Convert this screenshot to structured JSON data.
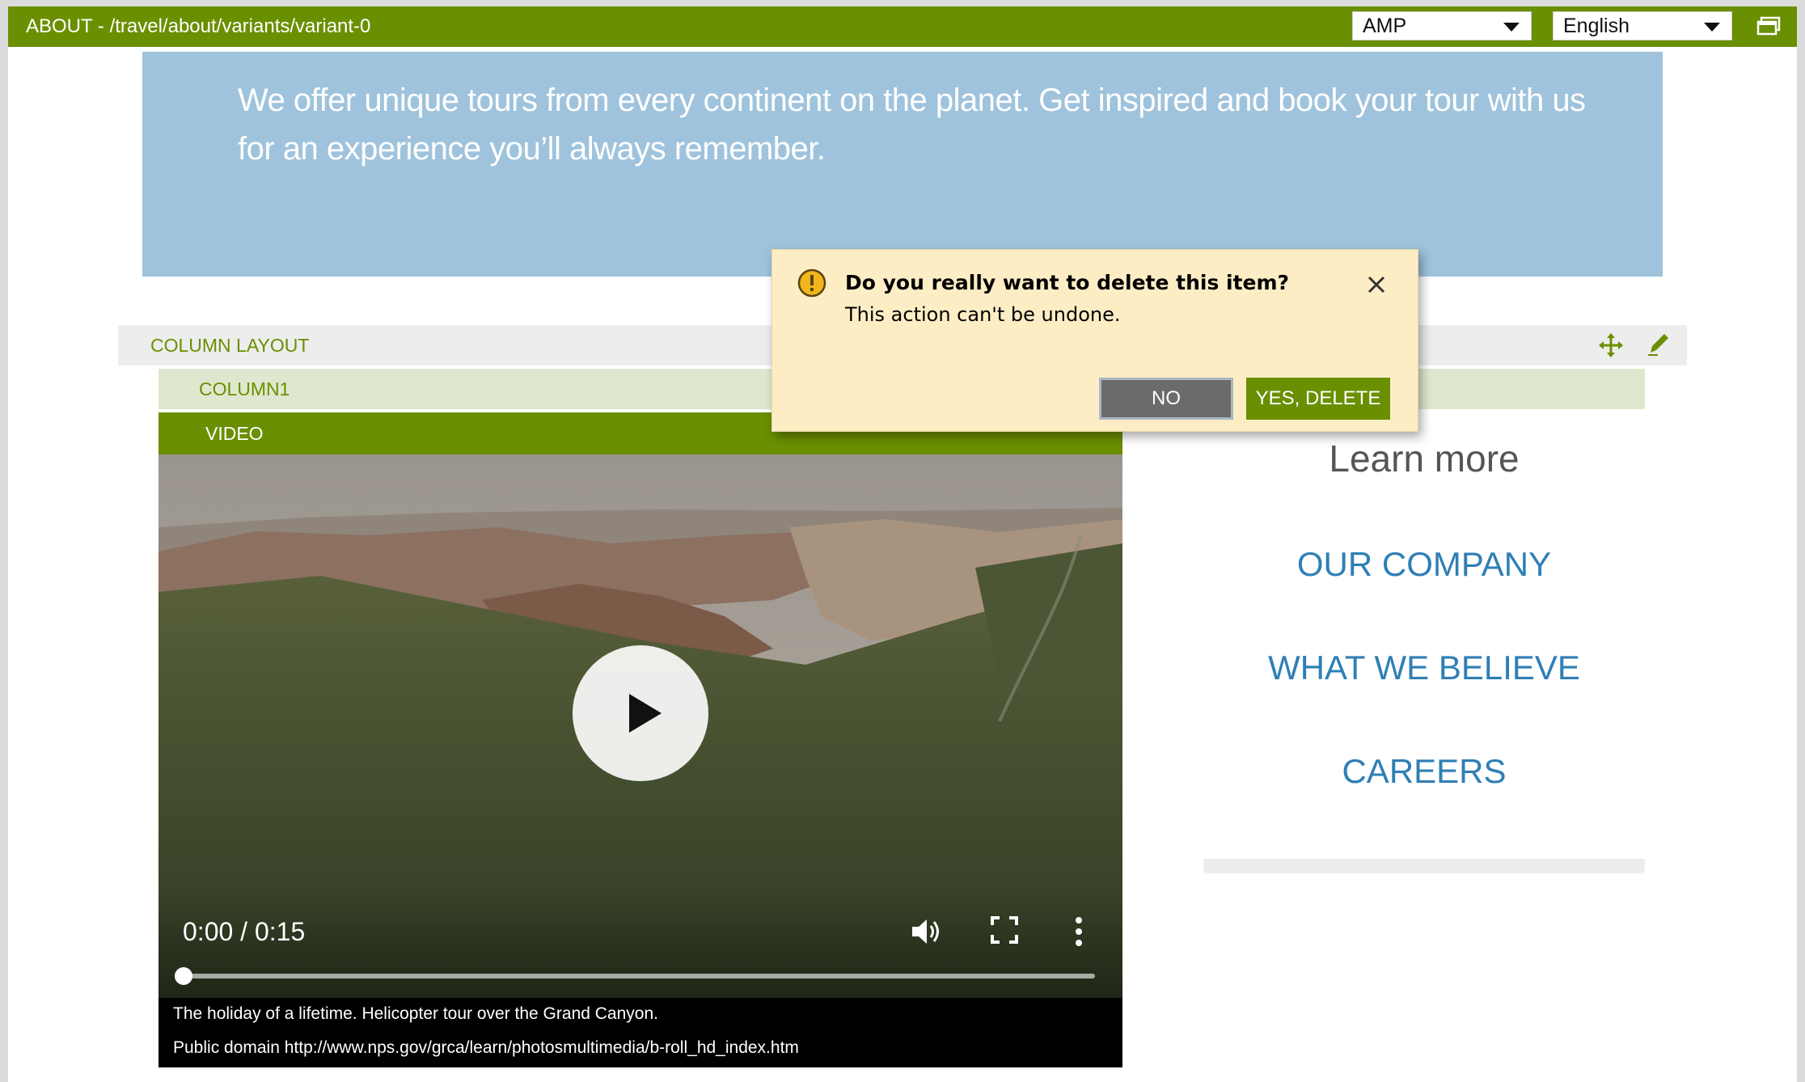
{
  "topbar": {
    "path": "ABOUT - /travel/about/variants/variant-0",
    "renderer_value": "AMP",
    "language_value": "English",
    "window_icon": "new-window-icon"
  },
  "hero": {
    "text": "We offer unique tours from every continent on the planet. Get inspired and book your tour with us for an experience you’ll always remember."
  },
  "column_layout": {
    "label": "COLUMN LAYOUT",
    "icons": [
      "move-icon",
      "edit-icon"
    ]
  },
  "column1": {
    "label": "COLUMN1"
  },
  "video": {
    "label": "VIDEO",
    "time": "0:00 / 0:15",
    "progress": 0,
    "caption_line1": "The holiday of a lifetime. Helicopter tour over the Grand Canyon.",
    "caption_line2": "Public domain http://www.nps.gov/grca/learn/photosmultimedia/b-roll_hd_index.htm",
    "icons": [
      "play-icon",
      "volume-icon",
      "fullscreen-icon",
      "more-options-icon"
    ]
  },
  "sidebar": {
    "heading": "Learn more",
    "links": [
      "OUR COMPANY",
      "WHAT WE BELIEVE",
      "CAREERS"
    ]
  },
  "dialog": {
    "title": "Do you really want to delete this item?",
    "message": "This action can't be undone.",
    "no_label": "NO",
    "yes_label": "YES, DELETE",
    "icons": [
      "warning-icon",
      "close-icon"
    ]
  },
  "colors": {
    "brand_green": "#6a8f00",
    "hero_blue": "#9fc3dc",
    "link_blue": "#2f7fb5",
    "dialog_bg": "#fdedc4"
  }
}
